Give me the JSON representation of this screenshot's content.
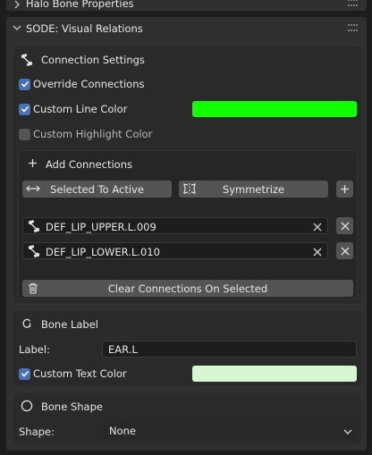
{
  "panels": {
    "halo": {
      "title": "Halo Bone Properties"
    },
    "sode": {
      "title": "SODE: Visual Relations"
    }
  },
  "connection_settings": {
    "title": "Connection Settings",
    "override_connections": {
      "label": "Override Connections",
      "checked": true
    },
    "custom_line_color": {
      "label": "Custom Line Color",
      "checked": true,
      "color": "#11ff00"
    },
    "custom_highlight_color": {
      "label": "Custom Highlight Color",
      "checked": false
    }
  },
  "add_connections": {
    "title": "Add Connections",
    "selected_to_active_label": "Selected To Active",
    "symmetrize_label": "Symmetrize",
    "bones": [
      {
        "name": "DEF_LIP_UPPER.L.009"
      },
      {
        "name": "DEF_LIP_LOWER.L.010"
      }
    ],
    "clear_label": "Clear Connections On Selected"
  },
  "bone_label": {
    "title": "Bone Label",
    "label_caption": "Label:",
    "label_value": "EAR.L",
    "custom_text_color": {
      "label": "Custom Text Color",
      "checked": true,
      "color": "#d7f7d2"
    }
  },
  "bone_shape": {
    "title": "Bone Shape",
    "shape_caption": "Shape:",
    "shape_value": "None"
  }
}
